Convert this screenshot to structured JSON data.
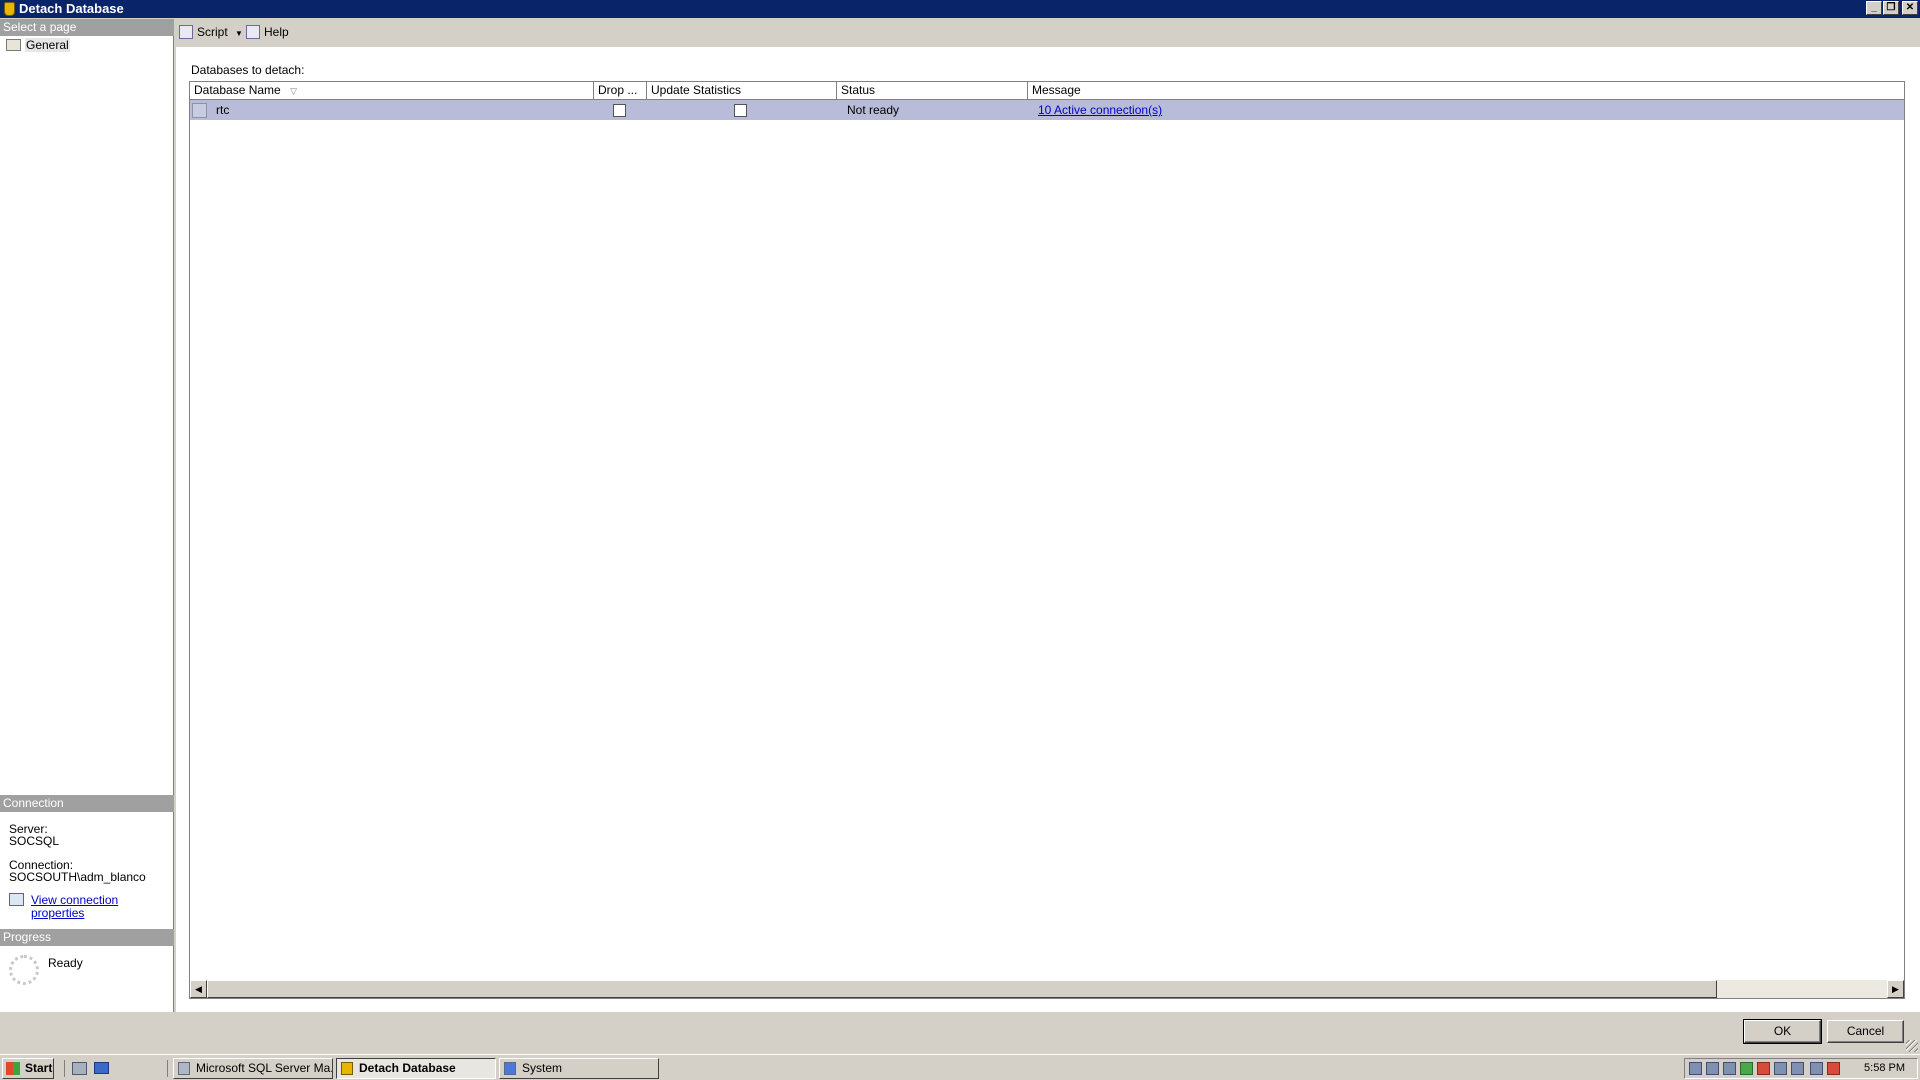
{
  "window": {
    "title": "Detach Database",
    "controls": [
      "minimize-icon",
      "restore-icon",
      "close-icon"
    ]
  },
  "left_panel": {
    "select_page_header": "Select a page",
    "pages": [
      {
        "label": "General",
        "icon": "general-page-icon",
        "selected": true
      }
    ],
    "connection_header": "Connection",
    "server_label": "Server:",
    "server_value": "SOCSQL",
    "connection_label": "Connection:",
    "connection_value": "SOCSOUTH\\adm_blanco",
    "view_properties_link": "View connection properties",
    "progress_header": "Progress",
    "progress_status": "Ready"
  },
  "toolbar": {
    "script_label": "Script",
    "help_label": "Help"
  },
  "main": {
    "section_label": "Databases to detach:",
    "columns": [
      "Database Name",
      "Drop ...",
      "Update Statistics",
      "Status",
      "Message"
    ],
    "rows": [
      {
        "database_name": "rtc",
        "drop_connections": false,
        "update_statistics": false,
        "status": "Not ready",
        "message": "10 Active connection(s)"
      }
    ]
  },
  "buttons": {
    "ok": "OK",
    "cancel": "Cancel"
  },
  "taskbar": {
    "start_label": "Start",
    "tasks": [
      {
        "label": "Microsoft SQL Server Ma...",
        "active": false
      },
      {
        "label": "Detach Database",
        "active": true
      },
      {
        "label": "System",
        "active": false
      }
    ],
    "clock": "5:58 PM"
  },
  "colors": {
    "titlebar": "#0a246a",
    "selected_row": "#b8bcd8",
    "section_header": "#a0a0a0",
    "link": "#0000cc"
  }
}
